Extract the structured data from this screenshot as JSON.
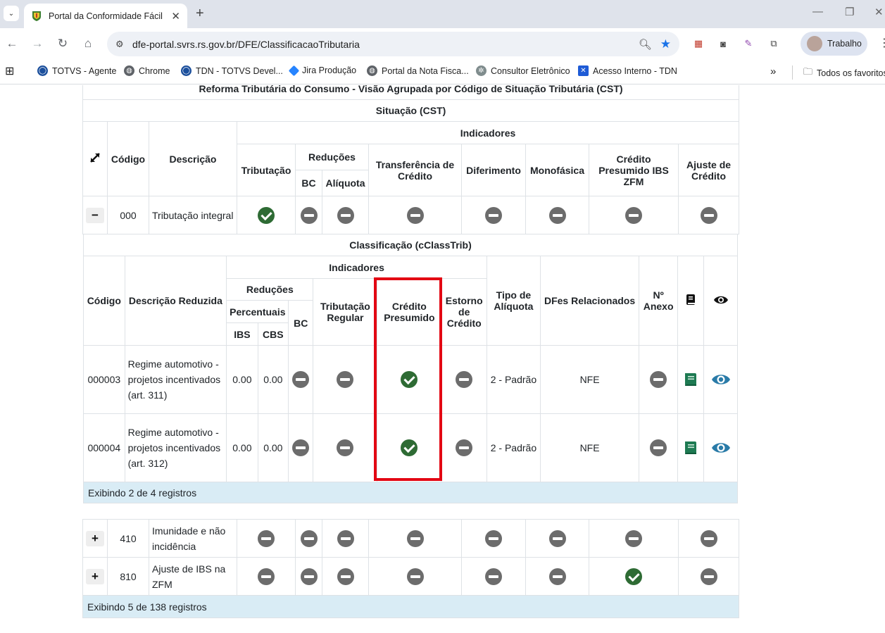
{
  "browser": {
    "tab_title": "Portal da Conformidade Fácil",
    "url": "dfe-portal.svrs.rs.gov.br/DFE/ClassificacaoTributaria",
    "profile_name": "Trabalho",
    "bookmarks": [
      "TOTVS - Agente",
      "Chrome",
      "TDN - TOTVS Devel...",
      "Jira Produção",
      "Portal da Nota Fisca...",
      "Consultor Eletrônico",
      "Acesso Interno - TDN"
    ],
    "all_bookmarks": "Todos os favoritos"
  },
  "cst_table": {
    "caption": "Reforma Tributária do Consumo - Visão Agrupada por Código de Situação Tributária (CST)",
    "title": "Situação (CST)",
    "headers": {
      "codigo": "Código",
      "descricao": "Descrição",
      "indicadores": "Indicadores",
      "tributacao": "Tributação",
      "reducoes": "Reduções",
      "bc": "BC",
      "aliquota": "Alíquota",
      "transferencia": "Transferência de Crédito",
      "diferimento": "Diferimento",
      "monofasica": "Monofásica",
      "credito_presumido_zfm": "Crédito Presumido IBS ZFM",
      "ajuste_credito": "Ajuste de Crédito"
    },
    "rows": [
      {
        "toggle": "−",
        "codigo": "000",
        "descricao": "Tributação integral",
        "flags": [
          "check",
          "minus",
          "minus",
          "minus",
          "minus",
          "minus",
          "minus",
          "minus"
        ]
      },
      {
        "toggle": "+",
        "codigo": "410",
        "descricao": "Imunidade e não incidência",
        "flags": [
          "minus",
          "minus",
          "minus",
          "minus",
          "minus",
          "minus",
          "minus",
          "minus"
        ]
      },
      {
        "toggle": "+",
        "codigo": "810",
        "descricao": "Ajuste de IBS na ZFM",
        "flags": [
          "minus",
          "minus",
          "minus",
          "minus",
          "minus",
          "minus",
          "check",
          "minus"
        ]
      }
    ],
    "footer": "Exibindo 5 de 138 registros"
  },
  "class_table": {
    "title": "Classificação (cClassTrib)",
    "headers": {
      "codigo": "Código",
      "descricao_reduzida": "Descrição Reduzida",
      "indicadores": "Indicadores",
      "reducoes": "Reduções",
      "percentuais": "Percentuais",
      "ibs": "IBS",
      "cbs": "CBS",
      "bc": "BC",
      "tributacao_regular": "Tributação Regular",
      "credito_presumido": "Crédito Presumido",
      "estorno_credito": "Estorno de Crédito",
      "tipo_aliquota": "Tipo de Alíquota",
      "dfes_relacionados": "DFes Relacionados",
      "n_anexo": "Nº Anexo"
    },
    "rows": [
      {
        "codigo": "000003",
        "descricao": "Regime automotivo - projetos incentivados (art. 311)",
        "ibs": "0.00",
        "cbs": "0.00",
        "bc": "minus",
        "tributacao_regular": "minus",
        "credito_presumido": "check",
        "estorno": "minus",
        "tipo_aliquota": "2 - Padrão",
        "dfes": "NFE",
        "anexo": "minus"
      },
      {
        "codigo": "000004",
        "descricao": "Regime automotivo - projetos incentivados (art. 312)",
        "ibs": "0.00",
        "cbs": "0.00",
        "bc": "minus",
        "tributacao_regular": "minus",
        "credito_presumido": "check",
        "estorno": "minus",
        "tipo_aliquota": "2 - Padrão",
        "dfes": "NFE",
        "anexo": "minus"
      }
    ],
    "footer": "Exibindo 2 de 4 registros"
  }
}
